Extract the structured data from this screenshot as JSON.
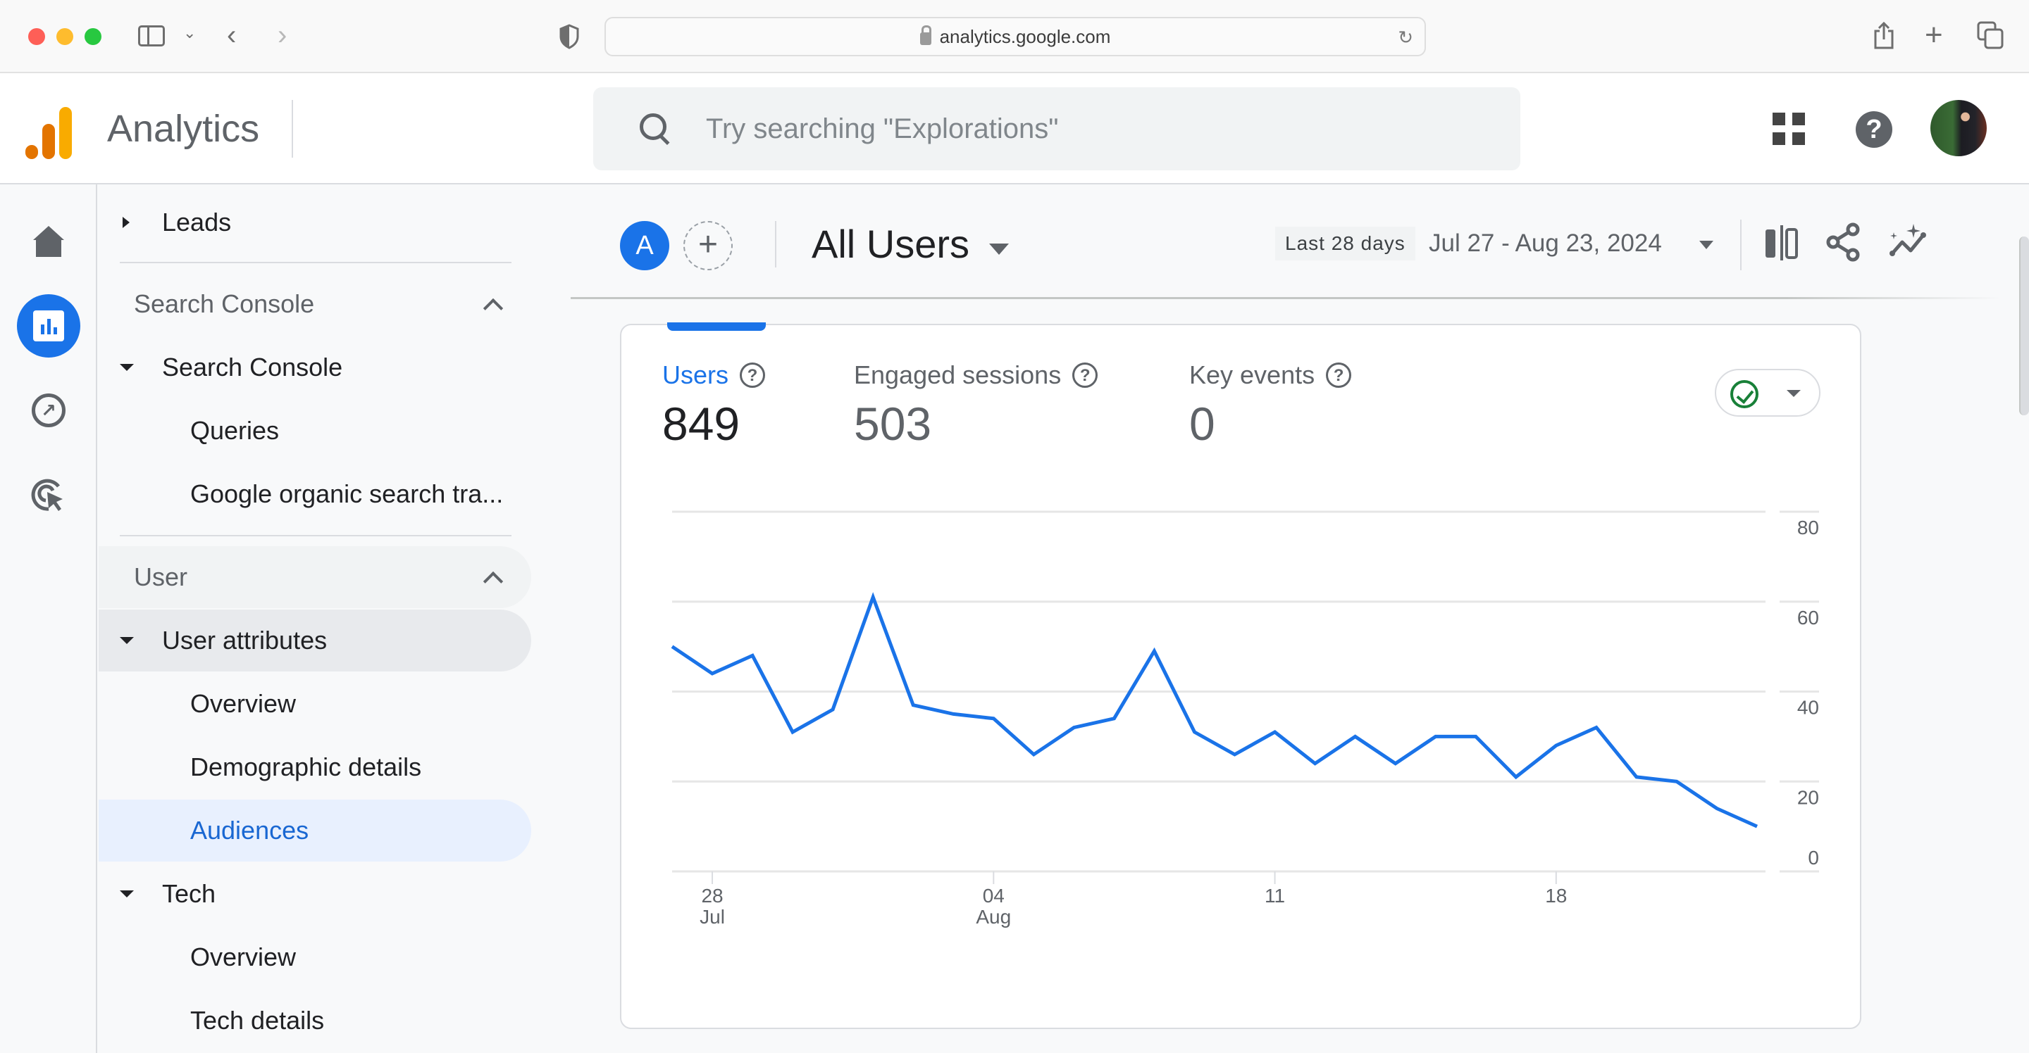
{
  "browser": {
    "url": "analytics.google.com"
  },
  "app": {
    "title": "Analytics",
    "search_placeholder": "Try searching \"Explorations\""
  },
  "rail": [
    {
      "name": "home",
      "icon": "home-icon",
      "active": false
    },
    {
      "name": "reports",
      "icon": "reports-icon",
      "active": true
    },
    {
      "name": "explore",
      "icon": "explore-icon",
      "active": false
    },
    {
      "name": "advertising",
      "icon": "advertising-icon",
      "active": false
    }
  ],
  "nav": {
    "leads": "Leads",
    "search_console_section": "Search Console",
    "search_console_group": "Search Console",
    "queries": "Queries",
    "organic": "Google organic search tra...",
    "user_section": "User",
    "user_attributes": "User attributes",
    "ua_overview": "Overview",
    "demographic_details": "Demographic details",
    "audiences": "Audiences",
    "tech": "Tech",
    "tech_overview": "Overview",
    "tech_details": "Tech details"
  },
  "header": {
    "segment_letter": "A",
    "add_segment": "+",
    "comparison_title": "All Users",
    "date_chip": "Last 28 days",
    "date_range": "Jul 27 - Aug 23, 2024"
  },
  "metrics": [
    {
      "label": "Users",
      "value": "849",
      "selected": true
    },
    {
      "label": "Engaged sessions",
      "value": "503",
      "selected": false
    },
    {
      "label": "Key events",
      "value": "0",
      "selected": false
    }
  ],
  "help_glyph": "?",
  "colors": {
    "accent": "#1a73e8",
    "line": "#1a73e8",
    "status_ok": "#188038"
  },
  "chart_data": {
    "type": "line",
    "title": "",
    "xlabel": "",
    "ylabel": "",
    "series": [
      {
        "name": "Users",
        "values": [
          50,
          44,
          48,
          31,
          36,
          61,
          37,
          35,
          34,
          26,
          32,
          34,
          49,
          31,
          26,
          31,
          24,
          30,
          24,
          30,
          30,
          21,
          28,
          32,
          21,
          20,
          14,
          10
        ]
      }
    ],
    "x": [
      "Jul 27",
      "Jul 28",
      "Jul 29",
      "Jul 30",
      "Jul 31",
      "Aug 01",
      "Aug 02",
      "Aug 03",
      "Aug 04",
      "Aug 05",
      "Aug 06",
      "Aug 07",
      "Aug 08",
      "Aug 09",
      "Aug 10",
      "Aug 11",
      "Aug 12",
      "Aug 13",
      "Aug 14",
      "Aug 15",
      "Aug 16",
      "Aug 17",
      "Aug 18",
      "Aug 19",
      "Aug 20",
      "Aug 21",
      "Aug 22",
      "Aug 23"
    ],
    "x_ticks": [
      {
        "index": 1,
        "day": "28",
        "month": "Jul"
      },
      {
        "index": 8,
        "day": "04",
        "month": "Aug"
      },
      {
        "index": 15,
        "day": "11",
        "month": ""
      },
      {
        "index": 22,
        "day": "18",
        "month": ""
      }
    ],
    "y_ticks": [
      0,
      20,
      40,
      60,
      80
    ],
    "ylim": [
      0,
      80
    ],
    "grid": true,
    "y_axis_side": "right"
  }
}
